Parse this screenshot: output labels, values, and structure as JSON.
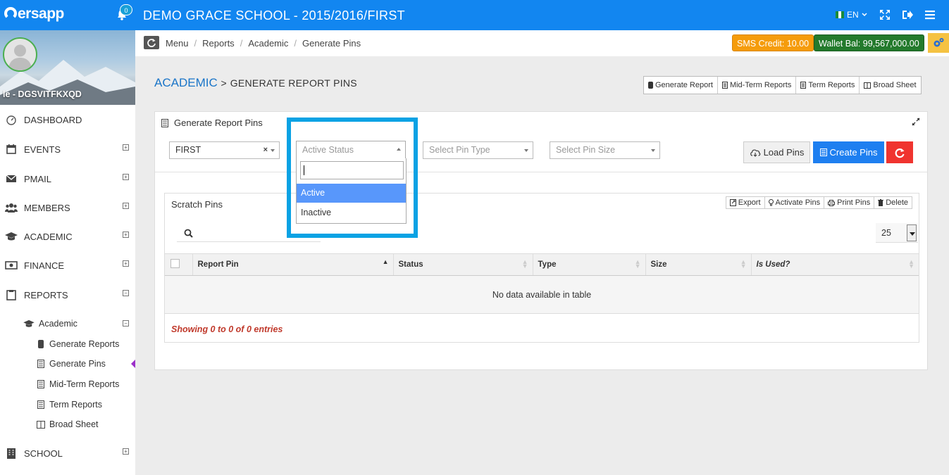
{
  "topbar": {
    "logo": "ersapp",
    "notification_count": "0",
    "title": "DEMO GRACE SCHOOL - 2015/2016/FIRST",
    "language": "EN"
  },
  "profile": {
    "name": "le - DGSVITFKXQD"
  },
  "sidebar": {
    "items": [
      {
        "label": "DASHBOARD",
        "icon": "dashboard-icon"
      },
      {
        "label": "EVENTS",
        "icon": "calendar-icon"
      },
      {
        "label": "PMAIL",
        "icon": "envelope-icon"
      },
      {
        "label": "MEMBERS",
        "icon": "users-icon"
      },
      {
        "label": "ACADEMIC",
        "icon": "graduation-cap-icon"
      },
      {
        "label": "FINANCE",
        "icon": "money-icon"
      },
      {
        "label": "REPORTS",
        "icon": "clipboard-icon"
      },
      {
        "label": "SCHOOL",
        "icon": "building-icon"
      }
    ],
    "expand_plus": "+",
    "expand_minus": "−",
    "submenu_title": "Academic",
    "sub_items": [
      {
        "label": "Generate Reports"
      },
      {
        "label": "Generate Pins"
      },
      {
        "label": "Mid-Term Reports"
      },
      {
        "label": "Term Reports"
      },
      {
        "label": "Broad Sheet"
      }
    ]
  },
  "breadcrumb": [
    "Menu",
    "Reports",
    "Academic",
    "Generate Pins"
  ],
  "badges": {
    "sms": "SMS Credit: 10.00",
    "wallet": "Wallet Bal: 99,567,000.00",
    "sms_color": "#f59c0c",
    "wallet_color": "#237a2c"
  },
  "heading": {
    "module": "ACADEMIC",
    "separator": ">",
    "page": "GENERATE REPORT PINS"
  },
  "report_buttons": [
    "Generate Report",
    "Mid-Term Reports",
    "Term Reports",
    "Broad Sheet"
  ],
  "panel": {
    "title": "Generate Report Pins",
    "term_value": "FIRST",
    "status_placeholder": "Active Status",
    "pin_type_placeholder": "Select Pin Type",
    "pin_size_placeholder": "Select Pin Size",
    "load_label": "Load Pins",
    "create_label": "Create Pins"
  },
  "dropdown": {
    "options": [
      "Active",
      "Inactive"
    ],
    "highlighted": "Active",
    "highlight_color": "#0aa2e4"
  },
  "scratch": {
    "title": "Scratch Pins",
    "tools": [
      "Export",
      "Activate Pins",
      "Print Pins",
      "Delete"
    ],
    "page_length": "25",
    "columns": [
      "Report Pin",
      "Status",
      "Type",
      "Size",
      "Is Used?"
    ],
    "empty_message": "No data available in table",
    "info": "Showing 0 to 0 of 0 entries"
  },
  "colors": {
    "primary": "#1286f0",
    "create": "#1e7ff0",
    "danger": "#f0342f",
    "active_caret": "#9b2fc9"
  }
}
